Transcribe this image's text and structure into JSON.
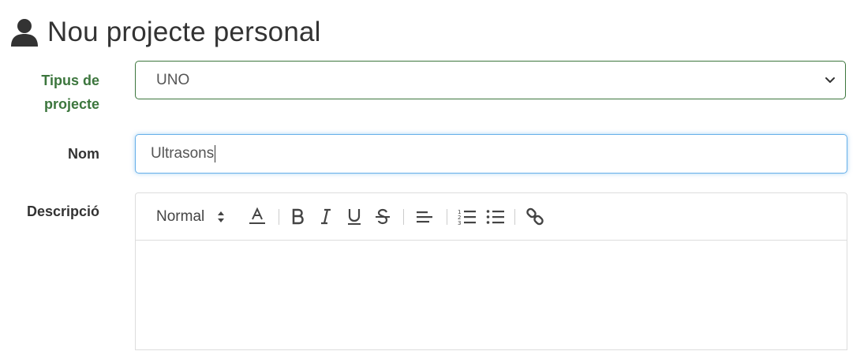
{
  "header": {
    "title": "Nou projecte personal",
    "icon": "user-icon"
  },
  "form": {
    "project_type": {
      "label_line1": "Tipus de",
      "label_line2": "projecte",
      "selected": "UNO"
    },
    "name": {
      "label": "Nom",
      "value": "Ultrasons"
    },
    "description": {
      "label": "Descripció",
      "toolbar": {
        "header_select": "Normal",
        "icons": [
          "text-color-icon",
          "bold-icon",
          "italic-icon",
          "underline-icon",
          "strike-icon",
          "align-icon",
          "ordered-list-icon",
          "bullet-list-icon",
          "link-icon"
        ]
      },
      "content": ""
    }
  },
  "colors": {
    "success": "#3c763d",
    "focus": "#66afe9",
    "text": "#333333"
  }
}
